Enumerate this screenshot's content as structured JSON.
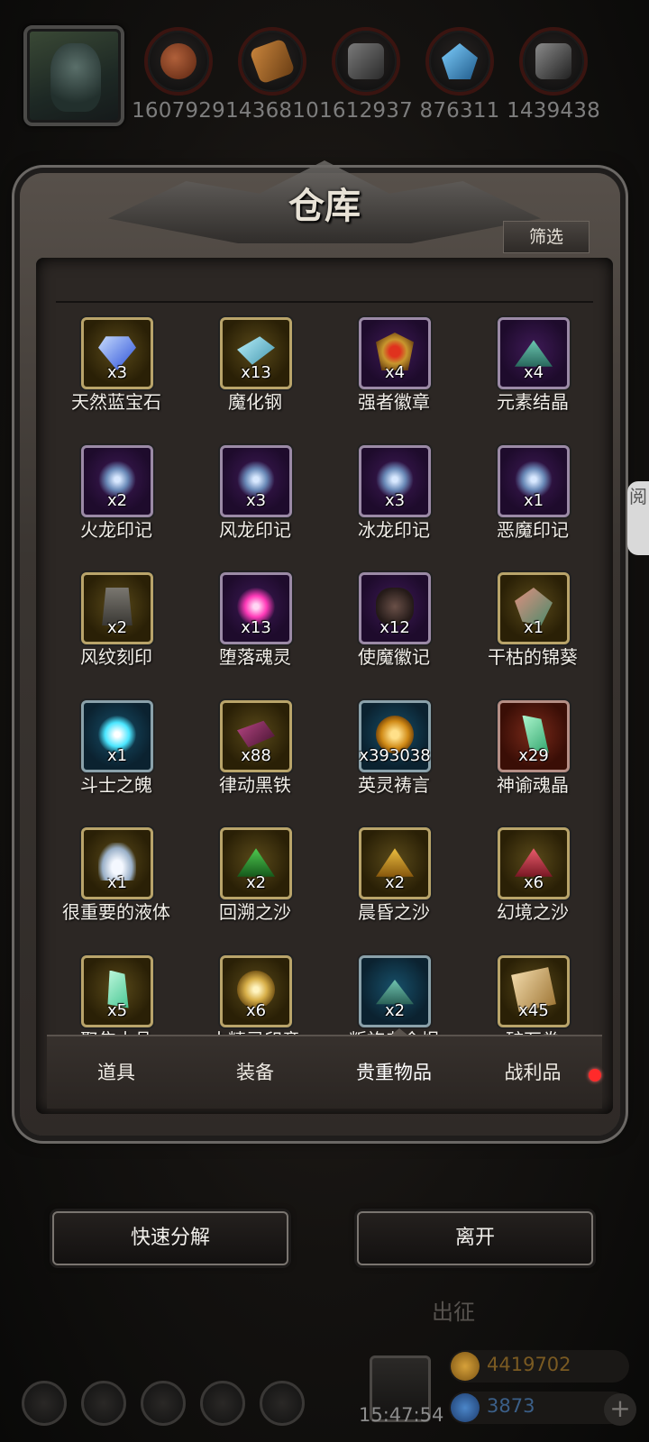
{
  "resources": [
    {
      "icon": "ore-bundle-icon",
      "value": "1607929"
    },
    {
      "icon": "wood-plank-icon",
      "value": "1436810"
    },
    {
      "icon": "iron-ingot-icon",
      "value": "1612937"
    },
    {
      "icon": "blue-crystal-icon",
      "value": "876311"
    },
    {
      "icon": "steel-ingot-icon",
      "value": "1439438"
    }
  ],
  "panel": {
    "title": "仓库",
    "filter_label": "筛选"
  },
  "items": [
    {
      "name": "天然蓝宝石",
      "qty": "x3",
      "frame": "gold",
      "icon": "sapphire-icon"
    },
    {
      "name": "魔化钢",
      "qty": "x13",
      "frame": "gold",
      "icon": "steel-bar-icon"
    },
    {
      "name": "强者徽章",
      "qty": "x4",
      "frame": "purple",
      "icon": "badge-icon"
    },
    {
      "name": "元素结晶",
      "qty": "x4",
      "frame": "purple",
      "icon": "crystal-pile-icon"
    },
    {
      "name": "火龙印记",
      "qty": "x2",
      "frame": "purple",
      "icon": "swirl-mark-icon"
    },
    {
      "name": "风龙印记",
      "qty": "x3",
      "frame": "purple",
      "icon": "swirl-mark-icon"
    },
    {
      "name": "冰龙印记",
      "qty": "x3",
      "frame": "purple",
      "icon": "swirl-mark-icon"
    },
    {
      "name": "恶魔印记",
      "qty": "x1",
      "frame": "purple",
      "icon": "swirl-mark-icon"
    },
    {
      "name": "风纹刻印",
      "qty": "x2",
      "frame": "gold",
      "icon": "rune-stone-icon"
    },
    {
      "name": "堕落魂灵",
      "qty": "x13",
      "frame": "purple",
      "icon": "soul-orb-icon"
    },
    {
      "name": "使魔徽记",
      "qty": "x12",
      "frame": "purple",
      "icon": "dark-rune-icon"
    },
    {
      "name": "干枯的锦葵",
      "qty": "x1",
      "frame": "gold",
      "icon": "leaf-icon"
    },
    {
      "name": "斗士之魄",
      "qty": "x1",
      "frame": "blue",
      "icon": "spirit-flame-icon"
    },
    {
      "name": "律动黑铁",
      "qty": "x88",
      "frame": "gold",
      "icon": "black-iron-icon"
    },
    {
      "name": "英灵祷言",
      "qty": "x393038",
      "frame": "blue",
      "icon": "golden-orb-icon"
    },
    {
      "name": "神谕魂晶",
      "qty": "x29",
      "frame": "red",
      "icon": "soul-crystal-icon"
    },
    {
      "name": "很重要的液体",
      "qty": "x1",
      "frame": "gold",
      "icon": "liquid-icon"
    },
    {
      "name": "回溯之沙",
      "qty": "x2",
      "frame": "gold",
      "icon": "green-sand-icon"
    },
    {
      "name": "晨昏之沙",
      "qty": "x2",
      "frame": "gold",
      "icon": "gold-sand-icon"
    },
    {
      "name": "幻境之沙",
      "qty": "x6",
      "frame": "gold",
      "icon": "red-sand-icon"
    },
    {
      "name": "聚焦水晶",
      "qty": "x5",
      "frame": "gold",
      "icon": "green-crystal-icon"
    },
    {
      "name": "古精灵印章",
      "qty": "x6",
      "frame": "gold",
      "icon": "elf-seal-icon"
    },
    {
      "name": "叛族者余烬",
      "qty": "x2",
      "frame": "blue",
      "icon": "ember-pile-icon"
    },
    {
      "name": "矿石卷",
      "qty": "x45",
      "frame": "gold",
      "icon": "scroll-icon"
    }
  ],
  "tabs": [
    {
      "label": "道具"
    },
    {
      "label": "装备"
    },
    {
      "label": "贵重物品"
    },
    {
      "label": "战利品"
    }
  ],
  "active_tab": "贵重物品",
  "buttons": {
    "decompose": "快速分解",
    "leave": "离开"
  },
  "side_tab_label": "阅",
  "hud": {
    "sortie": "出征",
    "time": "15:47:54",
    "gold": "4419702",
    "gems": "3873",
    "plus": "+"
  },
  "colors": {
    "gold_frame": "#b9a46a",
    "purple_frame": "#9b8aa6",
    "blue_frame": "#8aa1aa",
    "red_frame": "#b58e85",
    "notify_dot": "#ff2a2a"
  }
}
